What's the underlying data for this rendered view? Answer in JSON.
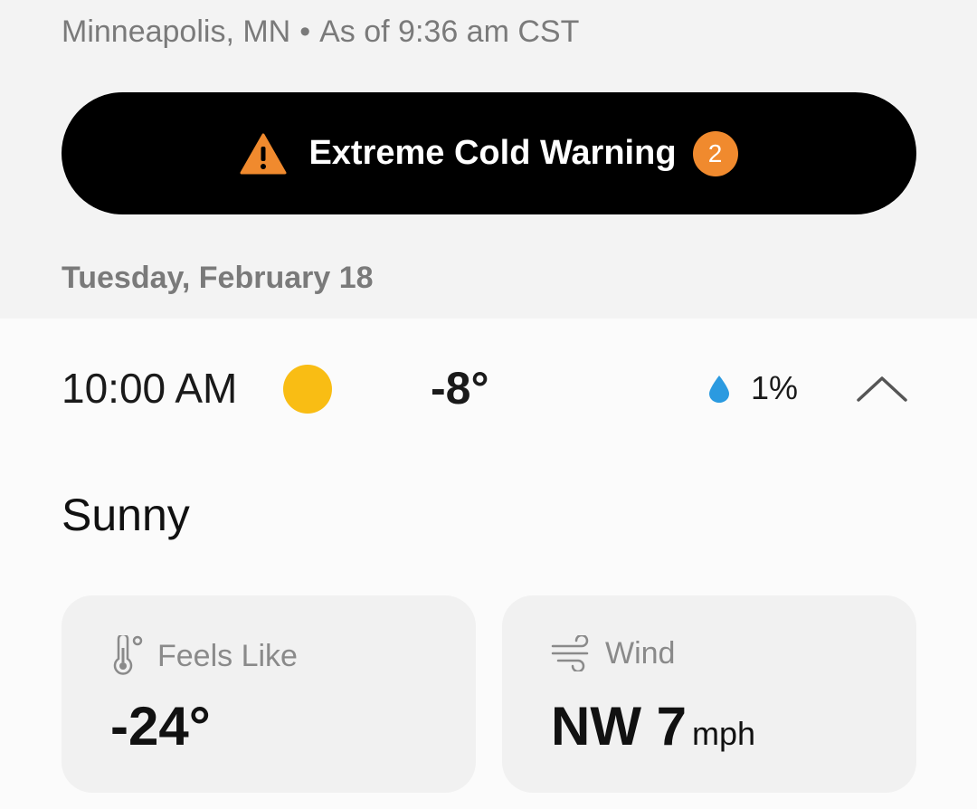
{
  "header": {
    "location": "Minneapolis, MN",
    "separator": "•",
    "as_of": "As of 9:36 am CST"
  },
  "alert": {
    "icon": "warning-triangle-icon",
    "text": "Extreme Cold Warning",
    "count": "2",
    "colors": {
      "background": "#000000",
      "icon": "#f08a2e",
      "badge": "#f08a2e"
    }
  },
  "date_header": "Tuesday, February 18",
  "hour": {
    "time": "10:00 AM",
    "icon": "sun-icon",
    "temp": "-8°",
    "precip_icon": "raindrop-icon",
    "precip": "1%",
    "toggle_icon": "chevron-up-icon"
  },
  "condition": "Sunny",
  "feels_like": {
    "icon": "thermometer-icon",
    "label": "Feels Like",
    "value": "-24°"
  },
  "wind": {
    "icon": "wind-icon",
    "label": "Wind",
    "value": "NW 7",
    "unit": "mph"
  }
}
